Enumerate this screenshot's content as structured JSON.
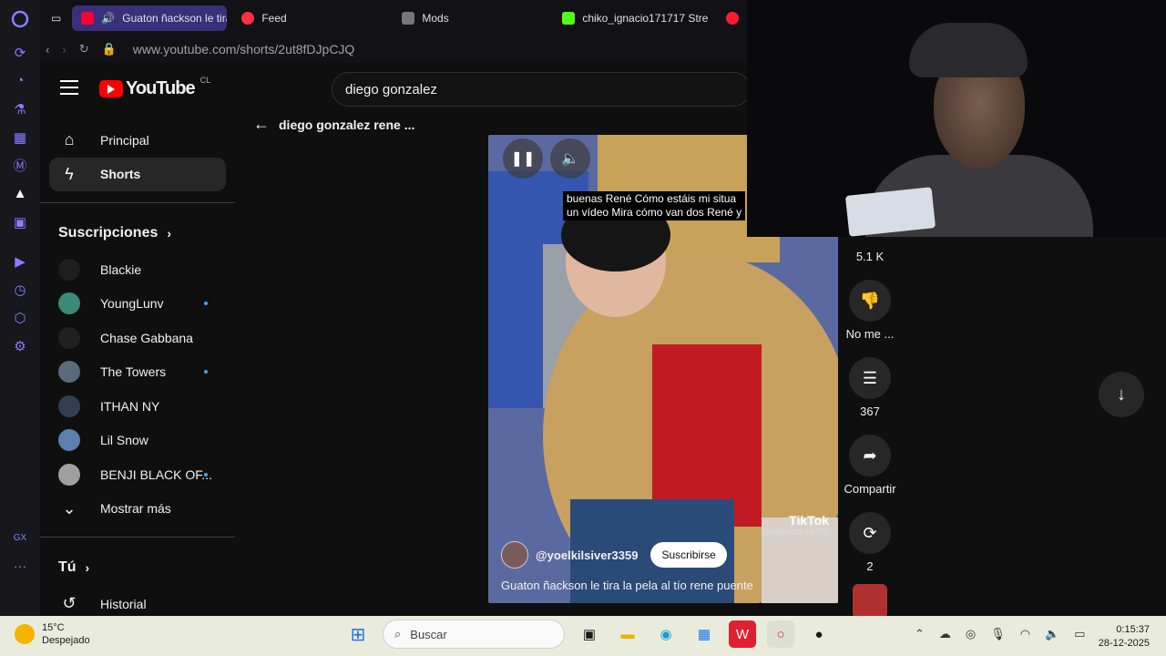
{
  "browser": {
    "tabs": [
      {
        "label": "Guaton ñackson le tira",
        "active": true,
        "color": "#ff0033"
      },
      {
        "label": "Feed",
        "active": false,
        "color": "#ff3040"
      },
      {
        "label": "Mods",
        "active": false,
        "color": "#777777"
      },
      {
        "label": "chiko_ignacio171717 Stre",
        "active": false,
        "color": "#53fc18"
      }
    ],
    "url": "www.youtube.com/shorts/2ut8fDJpCJQ"
  },
  "youtube": {
    "logo_text": "YouTube",
    "country": "CL",
    "search_value": "diego gonzalez",
    "short_header": "diego gonzalez rene ...",
    "nav": [
      {
        "label": "Principal",
        "icon": "home-icon"
      },
      {
        "label": "Shorts",
        "icon": "shorts-icon",
        "selected": true
      }
    ],
    "subscriptions_title": "Suscripciones",
    "subscriptions": [
      {
        "label": "Blackie",
        "dot": false,
        "color": "#1e1e1e"
      },
      {
        "label": "YoungLunv",
        "dot": true,
        "color": "#3a8a7a"
      },
      {
        "label": "Chase Gabbana",
        "dot": false,
        "color": "#202020"
      },
      {
        "label": "The Towers",
        "dot": true,
        "color": "#5a6a7a"
      },
      {
        "label": "ITHAN NY",
        "dot": false,
        "color": "#304050"
      },
      {
        "label": "Lil Snow",
        "dot": false,
        "color": "#5a80b0"
      },
      {
        "label": "BENJI BLACK OF...",
        "dot": true,
        "color": "#a0a0a0"
      }
    ],
    "show_more": "Mostrar más",
    "you_title": "Tú",
    "history": "Historial"
  },
  "short": {
    "caption_line1": "buenas René Cómo estáis mi situa",
    "caption_line2": "un vídeo Mira cómo van dos René y",
    "watermark": "TikTok",
    "watermark_user": "@valenzuela750",
    "channel": "@yoelkilsiver3359",
    "subscribe": "Suscribirse",
    "title": "Guaton ñackson le tira la pela al tío rene puente"
  },
  "actions": {
    "likes": "5.1 K",
    "dislike": "No me ...",
    "comments": "367",
    "share": "Compartir",
    "remix": "2"
  },
  "taskbar": {
    "temperature": "15°C",
    "weather": "Despejado",
    "search": "Buscar",
    "time": "0:15:37",
    "date": "28-12-2025"
  }
}
